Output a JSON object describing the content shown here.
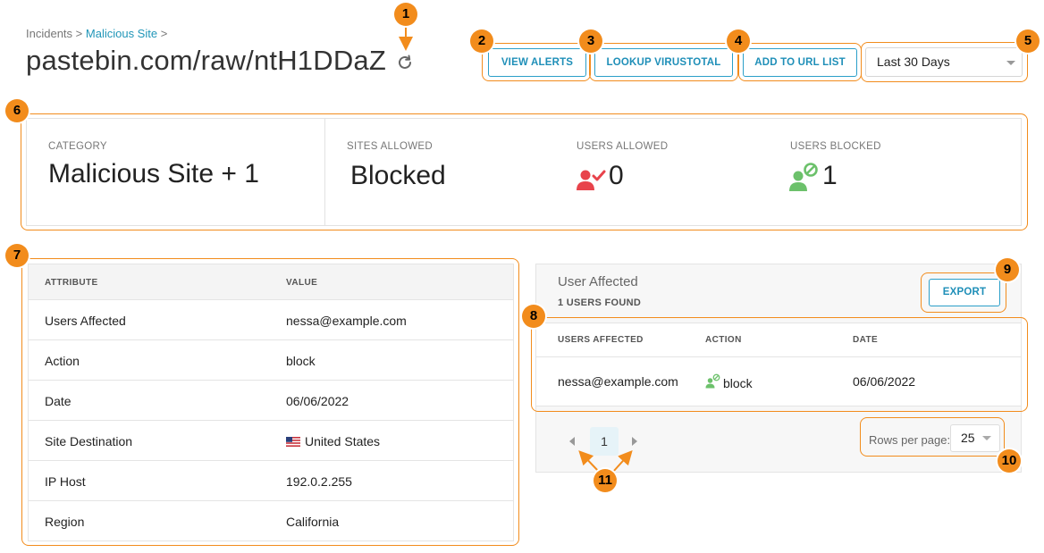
{
  "breadcrumb": {
    "root": "Incidents",
    "sep1": ">",
    "link": "Malicious Site",
    "sep2": ">"
  },
  "title": "pastebin.com/raw/ntH1DDaZ",
  "actions": {
    "view_alerts": "VIEW ALERTS",
    "lookup_virustotal": "LOOKUP VIRUSTOTAL",
    "add_to_url_list": "ADD TO URL LIST",
    "date_range": "Last 30 Days"
  },
  "summary": {
    "category_label": "CATEGORY",
    "category_value": "Malicious Site + 1",
    "sites_allowed_label": "SITES ALLOWED",
    "sites_allowed_value": "Blocked",
    "users_allowed_label": "USERS ALLOWED",
    "users_allowed_value": "0",
    "users_blocked_label": "USERS BLOCKED",
    "users_blocked_value": "1"
  },
  "attributes": {
    "header_attribute": "ATTRIBUTE",
    "header_value": "VALUE",
    "rows": [
      {
        "attribute": "Users Affected",
        "value": "nessa@example.com"
      },
      {
        "attribute": "Action",
        "value": "block"
      },
      {
        "attribute": "Date",
        "value": "06/06/2022"
      },
      {
        "attribute": "Site Destination",
        "value": "United States"
      },
      {
        "attribute": "IP Host",
        "value": "192.0.2.255"
      },
      {
        "attribute": "Region",
        "value": "California"
      }
    ]
  },
  "users_panel": {
    "title": "User Affected",
    "subtitle": "1 USERS FOUND",
    "export": "EXPORT",
    "col_users": "USERS AFFECTED",
    "col_action": "ACTION",
    "col_date": "DATE",
    "rows": [
      {
        "user": "nessa@example.com",
        "action": "block",
        "date": "06/06/2022"
      }
    ],
    "page": "1",
    "rows_per_page_label": "Rows per page:",
    "rows_per_page_value": "25"
  },
  "callouts": [
    "1",
    "2",
    "3",
    "4",
    "5",
    "6",
    "7",
    "8",
    "9",
    "10",
    "11"
  ],
  "colors": {
    "accent": "#2b9fc9",
    "annotation": "#f28c1c",
    "user_allowed_icon": "#e8434b",
    "user_blocked_icon": "#6cc16b"
  }
}
